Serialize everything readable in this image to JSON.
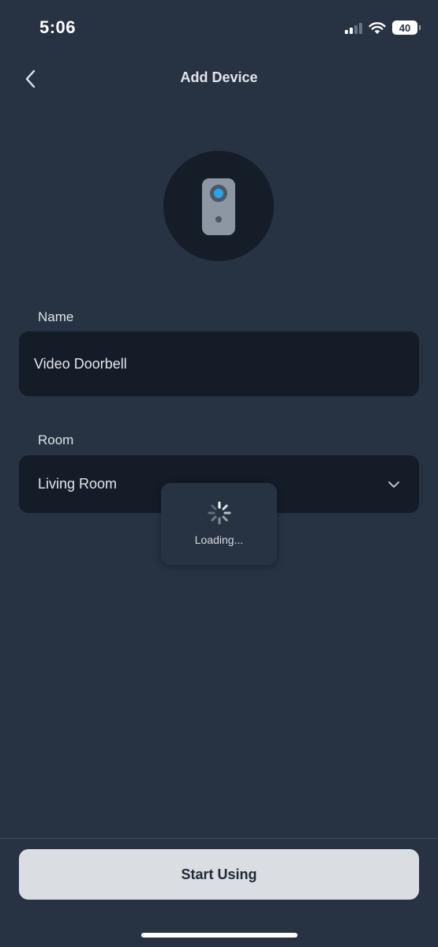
{
  "status_bar": {
    "time": "5:06",
    "battery_level": "40",
    "signal_icon": "cellular-signal-icon",
    "wifi_icon": "wifi-icon"
  },
  "header": {
    "title": "Add Device",
    "back_icon": "chevron-left-icon"
  },
  "device": {
    "icon": "video-doorbell-icon",
    "lens_color": "#22a7ee"
  },
  "form": {
    "name_label": "Name",
    "name_value": "Video Doorbell",
    "room_label": "Room",
    "room_value": "Living Room",
    "room_dropdown_icon": "chevron-down-icon"
  },
  "loading": {
    "text": "Loading...",
    "icon": "spinner-icon"
  },
  "footer": {
    "start_label": "Start Using"
  },
  "colors": {
    "background": "#273243",
    "field_background": "#141c28",
    "button_background": "#dadde1"
  }
}
